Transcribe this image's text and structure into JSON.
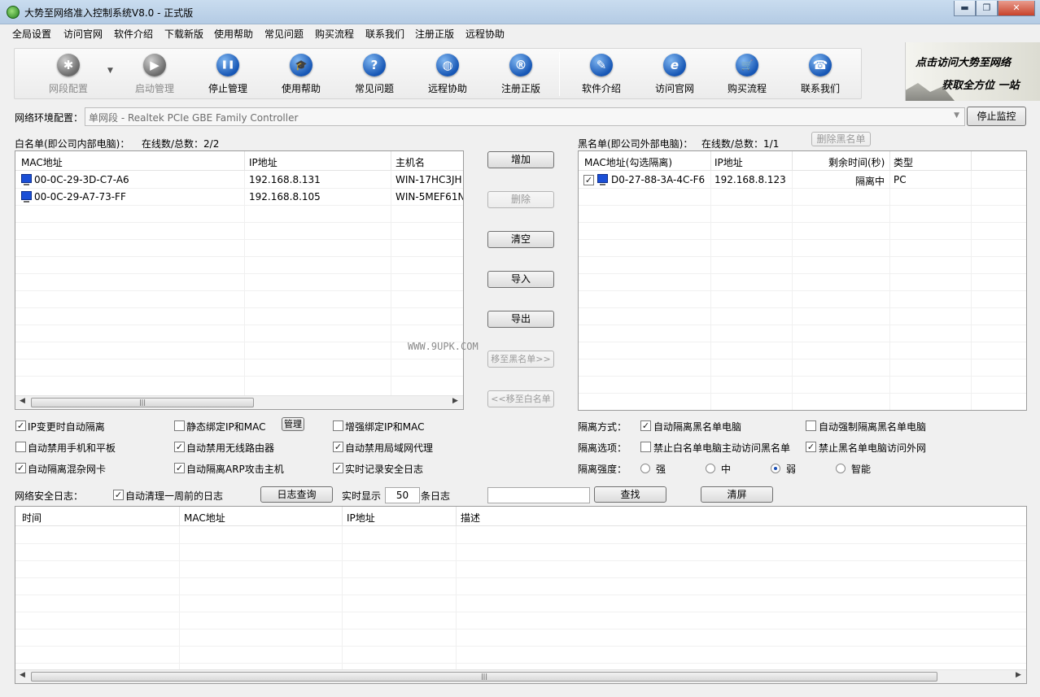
{
  "window": {
    "title": "大势至网络准入控制系统V8.0 - 正式版",
    "minimize": "▬",
    "maximize": "❐",
    "close": "✕"
  },
  "menu": [
    "全局设置",
    "访问官网",
    "软件介绍",
    "下载新版",
    "使用帮助",
    "常见问题",
    "购买流程",
    "联系我们",
    "注册正版",
    "远程协助"
  ],
  "toolbar": {
    "dropdown": "▼",
    "items": [
      {
        "label": "网段配置",
        "icon": "gear-icon",
        "glyph": "✱"
      },
      {
        "label": "启动管理",
        "icon": "play-icon",
        "glyph": "▶"
      },
      {
        "label": "停止管理",
        "icon": "pause-icon",
        "glyph": "❚❚"
      },
      {
        "label": "使用帮助",
        "icon": "graduation-cap-icon",
        "glyph": "🎓"
      },
      {
        "label": "常见问题",
        "icon": "question-icon",
        "glyph": "?"
      },
      {
        "label": "远程协助",
        "icon": "globe-icon",
        "glyph": "◍"
      },
      {
        "label": "注册正版",
        "icon": "registered-icon",
        "glyph": "®"
      },
      {
        "label": "软件介绍",
        "icon": "document-icon",
        "glyph": "✎"
      },
      {
        "label": "访问官网",
        "icon": "ie-icon",
        "glyph": "e"
      },
      {
        "label": "购买流程",
        "icon": "cart-icon",
        "glyph": "🛒"
      },
      {
        "label": "联系我们",
        "icon": "phone-icon",
        "glyph": "☎"
      }
    ]
  },
  "banner": {
    "line1": "点击访问大势至网络",
    "line2": "获取全方位 一站"
  },
  "network": {
    "label": "网络环境配置：",
    "value": "单网段 - Realtek PCIe GBE Family Controller",
    "caret": "▼",
    "stop_button": "停止监控"
  },
  "whitelist": {
    "title": "白名单(即公司内部电脑)：",
    "count": "在线数/总数：2/2",
    "columns": [
      "MAC地址",
      "IP地址",
      "主机名"
    ],
    "rows": [
      {
        "mac": "00-0C-29-3D-C7-A6",
        "ip": "192.168.8.131",
        "host": "WIN-17HC3JH"
      },
      {
        "mac": "00-0C-29-A7-73-FF",
        "ip": "192.168.8.105",
        "host": "WIN-5MEF61N"
      }
    ],
    "scroll_left": "◀",
    "scroll_right": "▶",
    "scroll_grip": "|||"
  },
  "mid_buttons": {
    "add": "增加",
    "delete": "删除",
    "clear": "清空",
    "import": "导入",
    "export": "导出",
    "move_black": "移至黑名单>>",
    "move_white": "<<移至白名单"
  },
  "watermark": "WWW.9UPK.COM",
  "blacklist": {
    "title": "黑名单(即公司外部电脑)：",
    "count": "在线数/总数：1/1",
    "delete_button": "删除黑名单",
    "columns": [
      "MAC地址(勾选隔离)",
      "IP地址",
      "剩余时间(秒)",
      "类型"
    ],
    "rows": [
      {
        "checked": "✓",
        "mac": "D0-27-88-3A-4C-F6",
        "ip": "192.168.8.123",
        "time": "隔离中",
        "type": "PC"
      }
    ]
  },
  "options_left": [
    {
      "label": "IP变更时自动隔离",
      "checked": "✓"
    },
    {
      "label": "静态绑定IP和MAC",
      "checked": ""
    },
    {
      "label": "增强绑定IP和MAC",
      "checked": ""
    },
    {
      "label": "自动禁用手机和平板",
      "checked": ""
    },
    {
      "label": "自动禁用无线路由器",
      "checked": "✓"
    },
    {
      "label": "自动禁用局域网代理",
      "checked": "✓"
    },
    {
      "label": "自动隔离混杂网卡",
      "checked": "✓"
    },
    {
      "label": "自动隔离ARP攻击主机",
      "checked": "✓"
    },
    {
      "label": "实时记录安全日志",
      "checked": "✓"
    }
  ],
  "manage_button": "管理",
  "isolation": {
    "mode_label": "隔离方式：",
    "mode_a": {
      "label": "自动隔离黑名单电脑",
      "checked": "✓"
    },
    "mode_b": {
      "label": "自动强制隔离黑名单电脑",
      "checked": ""
    },
    "options_label": "隔离选项：",
    "opt_a": {
      "label": "禁止白名单电脑主动访问黑名单",
      "checked": ""
    },
    "opt_b": {
      "label": "禁止黑名单电脑访问外网",
      "checked": "✓"
    },
    "strength_label": "隔离强度：",
    "strength": [
      "强",
      "中",
      "弱",
      "智能"
    ],
    "strength_selected": "弱"
  },
  "log": {
    "label": "网络安全日志：",
    "auto_clean": {
      "label": "自动清理一周前的日志",
      "checked": "✓"
    },
    "query_button": "日志查询",
    "realtime_label": "实时显示",
    "realtime_value": "50",
    "realtime_suffix": "条日志",
    "search_value": "",
    "search_button": "查找",
    "clear_button": "清屏",
    "columns": [
      "时间",
      "MAC地址",
      "IP地址",
      "描述"
    ]
  }
}
